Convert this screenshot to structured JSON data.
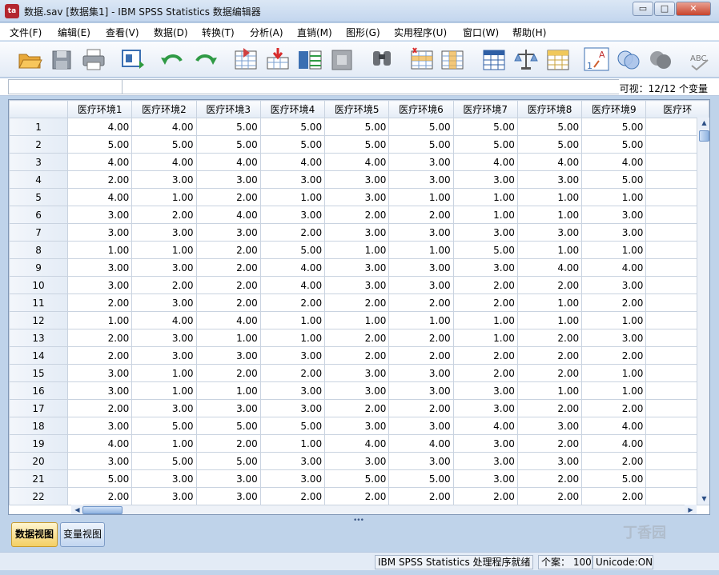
{
  "window": {
    "title": "数据.sav [数据集1] - IBM SPSS Statistics 数据编辑器",
    "icon_text": "ta",
    "controls": {
      "minimize": "▭",
      "maximize": "□",
      "close": "✕"
    }
  },
  "menu": [
    "文件(F)",
    "编辑(E)",
    "查看(V)",
    "数据(D)",
    "转换(T)",
    "分析(A)",
    "直销(M)",
    "图形(G)",
    "实用程序(U)",
    "窗口(W)",
    "帮助(H)"
  ],
  "toolbar": {
    "icons": [
      "open-folder-icon",
      "save-icon",
      "print-icon",
      "dialog-recall-icon",
      "undo-icon",
      "redo-icon",
      "goto-case-icon",
      "goto-variable-icon",
      "variables-icon",
      "run-descriptives-icon",
      "find-icon",
      "insert-cases-icon",
      "insert-variable-icon",
      "split-file-icon",
      "weight-cases-icon",
      "select-cases-icon",
      "value-labels-icon",
      "use-sets-icon",
      "show-all-variables-icon",
      "spell-check-icon"
    ],
    "value_labels_text": "A",
    "spell_text": "ABC"
  },
  "cell_editor": {
    "reference": "",
    "value": "",
    "visible_info": "可视：12/12 个变量"
  },
  "grid": {
    "columns": [
      "医疗环境1",
      "医疗环境2",
      "医疗环境3",
      "医疗环境4",
      "医疗环境5",
      "医疗环境6",
      "医疗环境7",
      "医疗环境8",
      "医疗环境9",
      "医疗环"
    ],
    "rows": [
      {
        "n": "1",
        "v": [
          "4.00",
          "4.00",
          "5.00",
          "5.00",
          "5.00",
          "5.00",
          "5.00",
          "5.00",
          "5.00",
          ""
        ]
      },
      {
        "n": "2",
        "v": [
          "5.00",
          "5.00",
          "5.00",
          "5.00",
          "5.00",
          "5.00",
          "5.00",
          "5.00",
          "5.00",
          ""
        ]
      },
      {
        "n": "3",
        "v": [
          "4.00",
          "4.00",
          "4.00",
          "4.00",
          "4.00",
          "3.00",
          "4.00",
          "4.00",
          "4.00",
          ""
        ]
      },
      {
        "n": "4",
        "v": [
          "2.00",
          "3.00",
          "3.00",
          "3.00",
          "3.00",
          "3.00",
          "3.00",
          "3.00",
          "5.00",
          ""
        ]
      },
      {
        "n": "5",
        "v": [
          "4.00",
          "1.00",
          "2.00",
          "1.00",
          "3.00",
          "1.00",
          "1.00",
          "1.00",
          "1.00",
          ""
        ]
      },
      {
        "n": "6",
        "v": [
          "3.00",
          "2.00",
          "4.00",
          "3.00",
          "2.00",
          "2.00",
          "1.00",
          "1.00",
          "3.00",
          ""
        ]
      },
      {
        "n": "7",
        "v": [
          "3.00",
          "3.00",
          "3.00",
          "2.00",
          "3.00",
          "3.00",
          "3.00",
          "3.00",
          "3.00",
          ""
        ]
      },
      {
        "n": "8",
        "v": [
          "1.00",
          "1.00",
          "2.00",
          "5.00",
          "1.00",
          "1.00",
          "5.00",
          "1.00",
          "1.00",
          ""
        ]
      },
      {
        "n": "9",
        "v": [
          "3.00",
          "3.00",
          "2.00",
          "4.00",
          "3.00",
          "3.00",
          "3.00",
          "4.00",
          "4.00",
          ""
        ]
      },
      {
        "n": "10",
        "v": [
          "3.00",
          "2.00",
          "2.00",
          "4.00",
          "3.00",
          "3.00",
          "2.00",
          "2.00",
          "3.00",
          ""
        ]
      },
      {
        "n": "11",
        "v": [
          "2.00",
          "3.00",
          "2.00",
          "2.00",
          "2.00",
          "2.00",
          "2.00",
          "1.00",
          "2.00",
          ""
        ]
      },
      {
        "n": "12",
        "v": [
          "1.00",
          "4.00",
          "4.00",
          "1.00",
          "1.00",
          "1.00",
          "1.00",
          "1.00",
          "1.00",
          ""
        ]
      },
      {
        "n": "13",
        "v": [
          "2.00",
          "3.00",
          "1.00",
          "1.00",
          "2.00",
          "2.00",
          "1.00",
          "2.00",
          "3.00",
          ""
        ]
      },
      {
        "n": "14",
        "v": [
          "2.00",
          "3.00",
          "3.00",
          "3.00",
          "2.00",
          "2.00",
          "2.00",
          "2.00",
          "2.00",
          ""
        ]
      },
      {
        "n": "15",
        "v": [
          "3.00",
          "1.00",
          "2.00",
          "2.00",
          "3.00",
          "3.00",
          "2.00",
          "2.00",
          "1.00",
          ""
        ]
      },
      {
        "n": "16",
        "v": [
          "3.00",
          "1.00",
          "1.00",
          "3.00",
          "3.00",
          "3.00",
          "3.00",
          "1.00",
          "1.00",
          ""
        ]
      },
      {
        "n": "17",
        "v": [
          "2.00",
          "3.00",
          "3.00",
          "3.00",
          "2.00",
          "2.00",
          "3.00",
          "2.00",
          "2.00",
          ""
        ]
      },
      {
        "n": "18",
        "v": [
          "3.00",
          "5.00",
          "5.00",
          "5.00",
          "3.00",
          "3.00",
          "4.00",
          "3.00",
          "4.00",
          ""
        ]
      },
      {
        "n": "19",
        "v": [
          "4.00",
          "1.00",
          "2.00",
          "1.00",
          "4.00",
          "4.00",
          "3.00",
          "2.00",
          "4.00",
          ""
        ]
      },
      {
        "n": "20",
        "v": [
          "3.00",
          "5.00",
          "5.00",
          "3.00",
          "3.00",
          "3.00",
          "3.00",
          "3.00",
          "2.00",
          ""
        ]
      },
      {
        "n": "21",
        "v": [
          "5.00",
          "3.00",
          "3.00",
          "3.00",
          "5.00",
          "5.00",
          "3.00",
          "2.00",
          "5.00",
          ""
        ]
      },
      {
        "n": "22",
        "v": [
          "2.00",
          "3.00",
          "3.00",
          "2.00",
          "2.00",
          "2.00",
          "2.00",
          "2.00",
          "2.00",
          ""
        ]
      }
    ]
  },
  "tabs": {
    "data_view": "数据视图",
    "variable_view": "变量视图"
  },
  "status": {
    "processor": "IBM SPSS Statistics 处理程序就绪",
    "cases": "个案： 100",
    "unicode": "Unicode:ON"
  },
  "watermark": "丁香园",
  "colors": {
    "accent": "#2c4f86",
    "active_tab": "#f4cf64",
    "close_button": "#c8432c"
  }
}
